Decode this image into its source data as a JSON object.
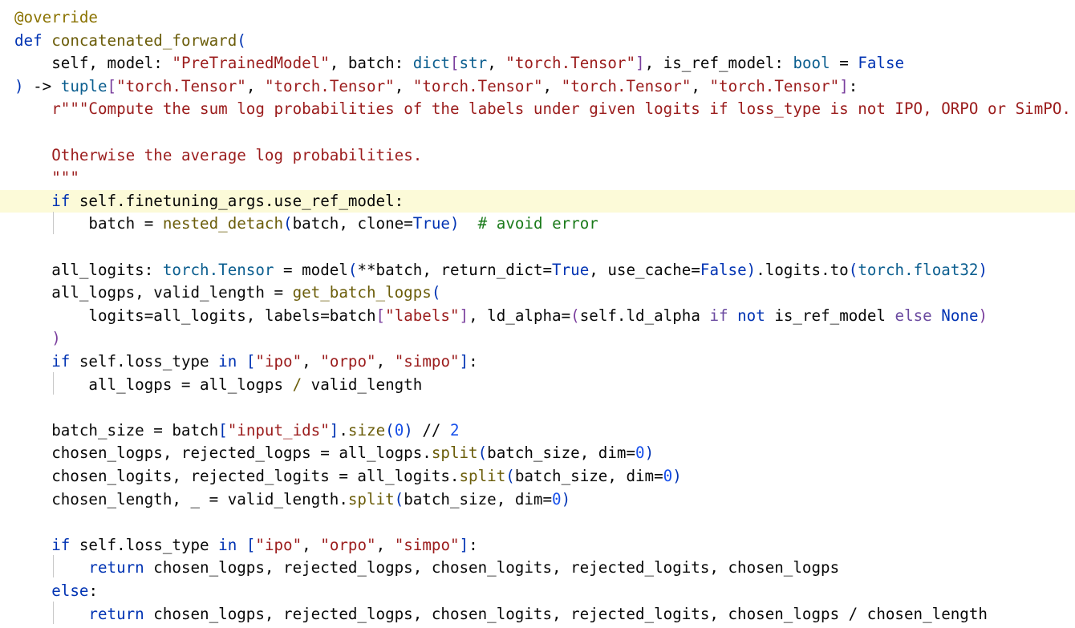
{
  "editor": {
    "highlighted_line": 9,
    "lines": [
      [
        {
          "t": "@override",
          "c": "d"
        }
      ],
      [
        {
          "t": "def",
          "c": "k"
        },
        {
          "t": " "
        },
        {
          "t": "concatenated_forward",
          "c": "f"
        },
        {
          "t": "(",
          "c": "p1"
        }
      ],
      [
        {
          "t": "    self, model: "
        },
        {
          "t": "\"PreTrainedModel\"",
          "c": "s"
        },
        {
          "t": ", batch: "
        },
        {
          "t": "dict",
          "c": "t"
        },
        {
          "t": "[",
          "c": "p2"
        },
        {
          "t": "str",
          "c": "t"
        },
        {
          "t": ", "
        },
        {
          "t": "\"torch.Tensor\"",
          "c": "s"
        },
        {
          "t": "]",
          "c": "p2"
        },
        {
          "t": ", is_ref_model: "
        },
        {
          "t": "bool",
          "c": "t"
        },
        {
          "t": " = "
        },
        {
          "t": "False",
          "c": "k"
        }
      ],
      [
        {
          "t": ")",
          "c": "p1"
        },
        {
          "t": " -> "
        },
        {
          "t": "tuple",
          "c": "t"
        },
        {
          "t": "[",
          "c": "p2"
        },
        {
          "t": "\"torch.Tensor\"",
          "c": "s"
        },
        {
          "t": ", "
        },
        {
          "t": "\"torch.Tensor\"",
          "c": "s"
        },
        {
          "t": ", "
        },
        {
          "t": "\"torch.Tensor\"",
          "c": "s"
        },
        {
          "t": ", "
        },
        {
          "t": "\"torch.Tensor\"",
          "c": "s"
        },
        {
          "t": ", "
        },
        {
          "t": "\"torch.Tensor\"",
          "c": "s"
        },
        {
          "t": "]",
          "c": "p2"
        },
        {
          "t": ":"
        }
      ],
      [
        {
          "t": "    "
        },
        {
          "t": "r\"\"\"Compute the sum log probabilities of the labels under given logits if loss_type is not IPO, ORPO or SimPO.",
          "c": "s"
        }
      ],
      [
        {
          "t": ""
        }
      ],
      [
        {
          "t": "    "
        },
        {
          "t": "Otherwise the average log probabilities.",
          "c": "s"
        }
      ],
      [
        {
          "t": "    "
        },
        {
          "t": "\"\"\"",
          "c": "s"
        }
      ],
      [
        {
          "t": "    "
        },
        {
          "t": "if",
          "c": "k"
        },
        {
          "t": " self.finetuning_args.use_ref_model:"
        }
      ],
      [
        {
          "t": "        batch = "
        },
        {
          "t": "nested_detach",
          "c": "f"
        },
        {
          "t": "(",
          "c": "p1"
        },
        {
          "t": "batch, clone="
        },
        {
          "t": "True",
          "c": "k"
        },
        {
          "t": ")",
          "c": "p1"
        },
        {
          "t": "  "
        },
        {
          "t": "# avoid error",
          "c": "c"
        }
      ],
      [
        {
          "t": ""
        }
      ],
      [
        {
          "t": "    all_logits: "
        },
        {
          "t": "torch.Tensor",
          "c": "t"
        },
        {
          "t": " = model"
        },
        {
          "t": "(",
          "c": "p1"
        },
        {
          "t": "**batch, return_dict="
        },
        {
          "t": "True",
          "c": "k"
        },
        {
          "t": ", use_cache="
        },
        {
          "t": "False",
          "c": "k"
        },
        {
          "t": ")",
          "c": "p1"
        },
        {
          "t": ".logits.to"
        },
        {
          "t": "(",
          "c": "p1"
        },
        {
          "t": "torch.float32",
          "c": "t"
        },
        {
          "t": ")",
          "c": "p1"
        }
      ],
      [
        {
          "t": "    all_logps, valid_length = "
        },
        {
          "t": "get_batch_logps",
          "c": "f"
        },
        {
          "t": "(",
          "c": "p1"
        }
      ],
      [
        {
          "t": "        logits=all_logits, labels=batch"
        },
        {
          "t": "[",
          "c": "p2"
        },
        {
          "t": "\"labels\"",
          "c": "s"
        },
        {
          "t": "]",
          "c": "p2"
        },
        {
          "t": ", ld_alpha="
        },
        {
          "t": "(",
          "c": "p2"
        },
        {
          "t": "self.ld_alpha "
        },
        {
          "t": "if",
          "c": "o"
        },
        {
          "t": " "
        },
        {
          "t": "not",
          "c": "k"
        },
        {
          "t": " is_ref_model "
        },
        {
          "t": "else",
          "c": "o"
        },
        {
          "t": " "
        },
        {
          "t": "None",
          "c": "k"
        },
        {
          "t": ")",
          "c": "p2"
        }
      ],
      [
        {
          "t": "    "
        },
        {
          "t": ")",
          "c": "p2"
        }
      ],
      [
        {
          "t": "    "
        },
        {
          "t": "if",
          "c": "k"
        },
        {
          "t": " self.loss_type "
        },
        {
          "t": "in",
          "c": "k"
        },
        {
          "t": " "
        },
        {
          "t": "[",
          "c": "p1"
        },
        {
          "t": "\"ipo\"",
          "c": "s"
        },
        {
          "t": ", "
        },
        {
          "t": "\"orpo\"",
          "c": "s"
        },
        {
          "t": ", "
        },
        {
          "t": "\"simpo\"",
          "c": "s"
        },
        {
          "t": "]",
          "c": "p1"
        },
        {
          "t": ":"
        }
      ],
      [
        {
          "t": "        all_logps = all_logps "
        },
        {
          "t": "/",
          "c": "f"
        },
        {
          "t": " valid_length"
        }
      ],
      [
        {
          "t": ""
        }
      ],
      [
        {
          "t": "    batch_size = batch"
        },
        {
          "t": "[",
          "c": "p1"
        },
        {
          "t": "\"input_ids\"",
          "c": "s"
        },
        {
          "t": "]",
          "c": "p1"
        },
        {
          "t": "."
        },
        {
          "t": "size",
          "c": "f"
        },
        {
          "t": "(",
          "c": "p1"
        },
        {
          "t": "0",
          "c": "n"
        },
        {
          "t": ")",
          "c": "p1"
        },
        {
          "t": " // "
        },
        {
          "t": "2",
          "c": "n"
        }
      ],
      [
        {
          "t": "    chosen_logps, rejected_logps = all_logps."
        },
        {
          "t": "split",
          "c": "f"
        },
        {
          "t": "(",
          "c": "p1"
        },
        {
          "t": "batch_size, dim="
        },
        {
          "t": "0",
          "c": "n"
        },
        {
          "t": ")",
          "c": "p1"
        }
      ],
      [
        {
          "t": "    chosen_logits, rejected_logits = all_logits."
        },
        {
          "t": "split",
          "c": "f"
        },
        {
          "t": "(",
          "c": "p1"
        },
        {
          "t": "batch_size, dim="
        },
        {
          "t": "0",
          "c": "n"
        },
        {
          "t": ")",
          "c": "p1"
        }
      ],
      [
        {
          "t": "    chosen_length, _ = valid_length."
        },
        {
          "t": "split",
          "c": "f"
        },
        {
          "t": "(",
          "c": "p1"
        },
        {
          "t": "batch_size, dim="
        },
        {
          "t": "0",
          "c": "n"
        },
        {
          "t": ")",
          "c": "p1"
        }
      ],
      [
        {
          "t": ""
        }
      ],
      [
        {
          "t": "    "
        },
        {
          "t": "if",
          "c": "k"
        },
        {
          "t": " self.loss_type "
        },
        {
          "t": "in",
          "c": "k"
        },
        {
          "t": " "
        },
        {
          "t": "[",
          "c": "p1"
        },
        {
          "t": "\"ipo\"",
          "c": "s"
        },
        {
          "t": ", "
        },
        {
          "t": "\"orpo\"",
          "c": "s"
        },
        {
          "t": ", "
        },
        {
          "t": "\"simpo\"",
          "c": "s"
        },
        {
          "t": "]",
          "c": "p1"
        },
        {
          "t": ":"
        }
      ],
      [
        {
          "t": "        "
        },
        {
          "t": "return",
          "c": "k"
        },
        {
          "t": " chosen_logps, rejected_logps, chosen_logits, rejected_logits, chosen_logps"
        }
      ],
      [
        {
          "t": "    "
        },
        {
          "t": "else",
          "c": "k"
        },
        {
          "t": ":"
        }
      ],
      [
        {
          "t": "        "
        },
        {
          "t": "return",
          "c": "k"
        },
        {
          "t": " chosen_logps, rejected_logps, chosen_logits, rejected_logits, chosen_logps / chosen_length"
        }
      ]
    ]
  }
}
